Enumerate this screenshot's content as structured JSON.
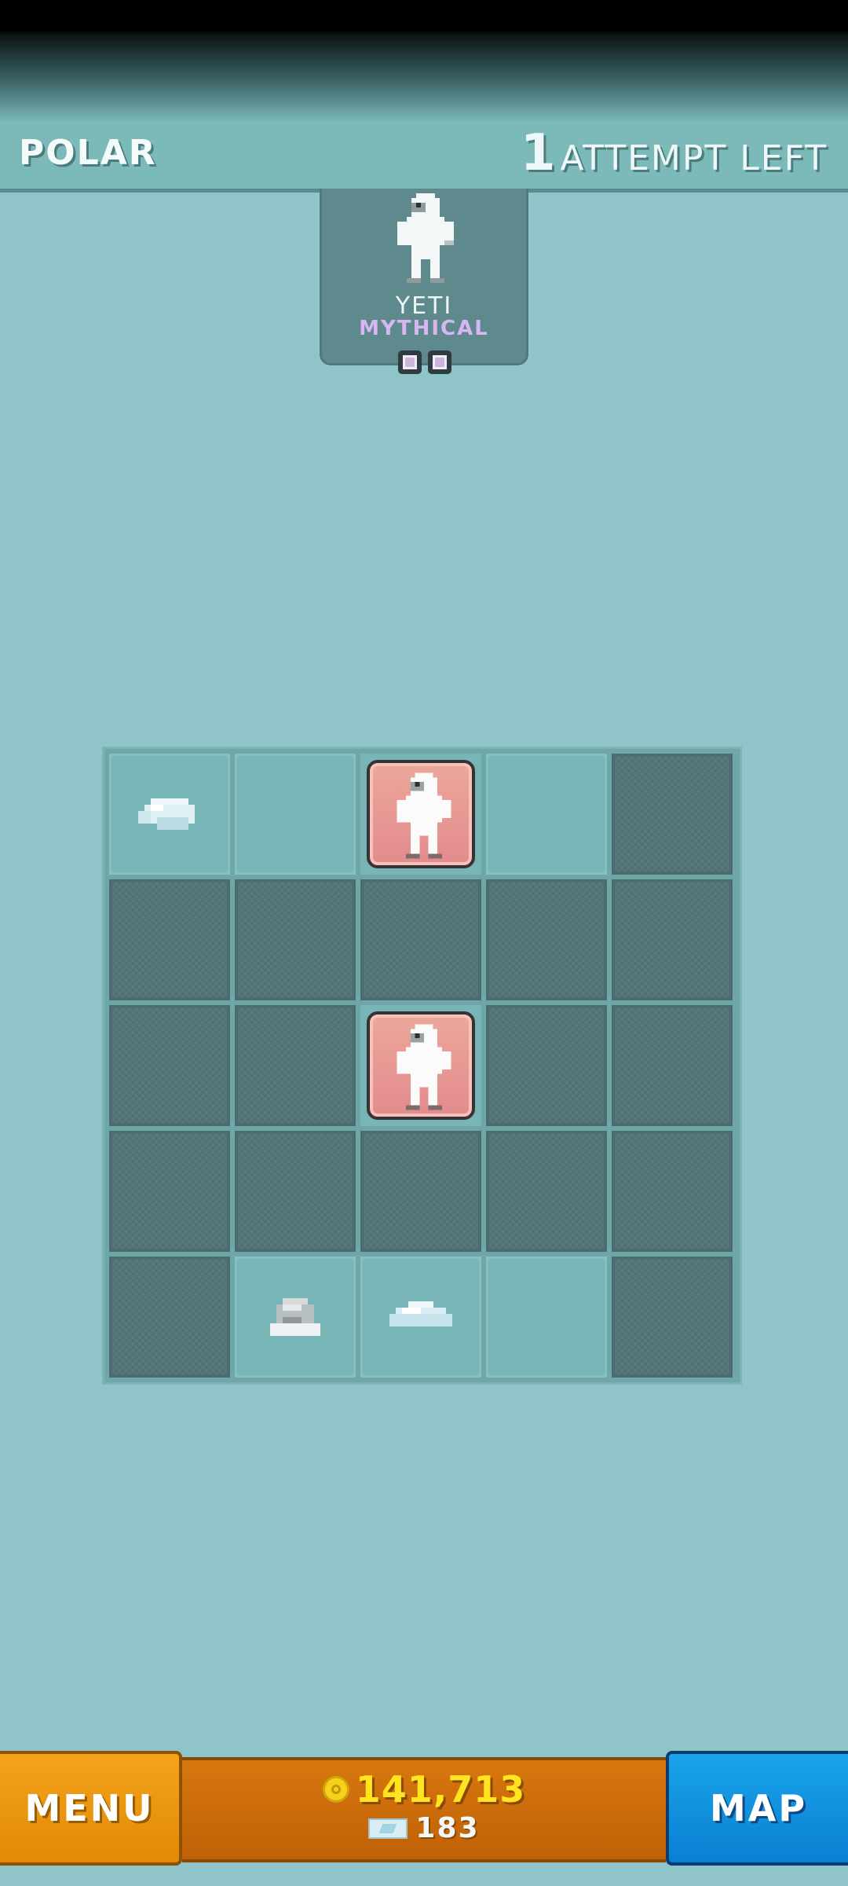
{
  "header": {
    "title": "POLAR",
    "attempts_count": "1",
    "attempts_label": "ATTEMPT LEFT"
  },
  "target": {
    "name": "YETI",
    "rarity": "MYTHICAL",
    "pips_total": 2,
    "icon": "yeti-sprite"
  },
  "board": {
    "rows": 5,
    "cols": 5,
    "cells": [
      [
        "ice-chunk",
        "empty",
        "yeti",
        "empty",
        "covered"
      ],
      [
        "covered",
        "covered",
        "covered",
        "covered",
        "covered"
      ],
      [
        "covered",
        "covered",
        "yeti",
        "covered",
        "covered"
      ],
      [
        "covered",
        "covered",
        "covered",
        "covered",
        "covered"
      ],
      [
        "covered",
        "rock",
        "snow-drift",
        "empty",
        "covered"
      ]
    ]
  },
  "footer": {
    "menu_label": "MENU",
    "coins": "141,713",
    "gems": "183",
    "map_label": "MAP"
  },
  "colors": {
    "background": "#8fc4c8",
    "found_tile": "#e48b8e",
    "rarity_mythical": "#d8b6f2",
    "menu_button": "#f6a21d",
    "map_button": "#1aa3ec",
    "coin_text": "#ffe41f"
  }
}
